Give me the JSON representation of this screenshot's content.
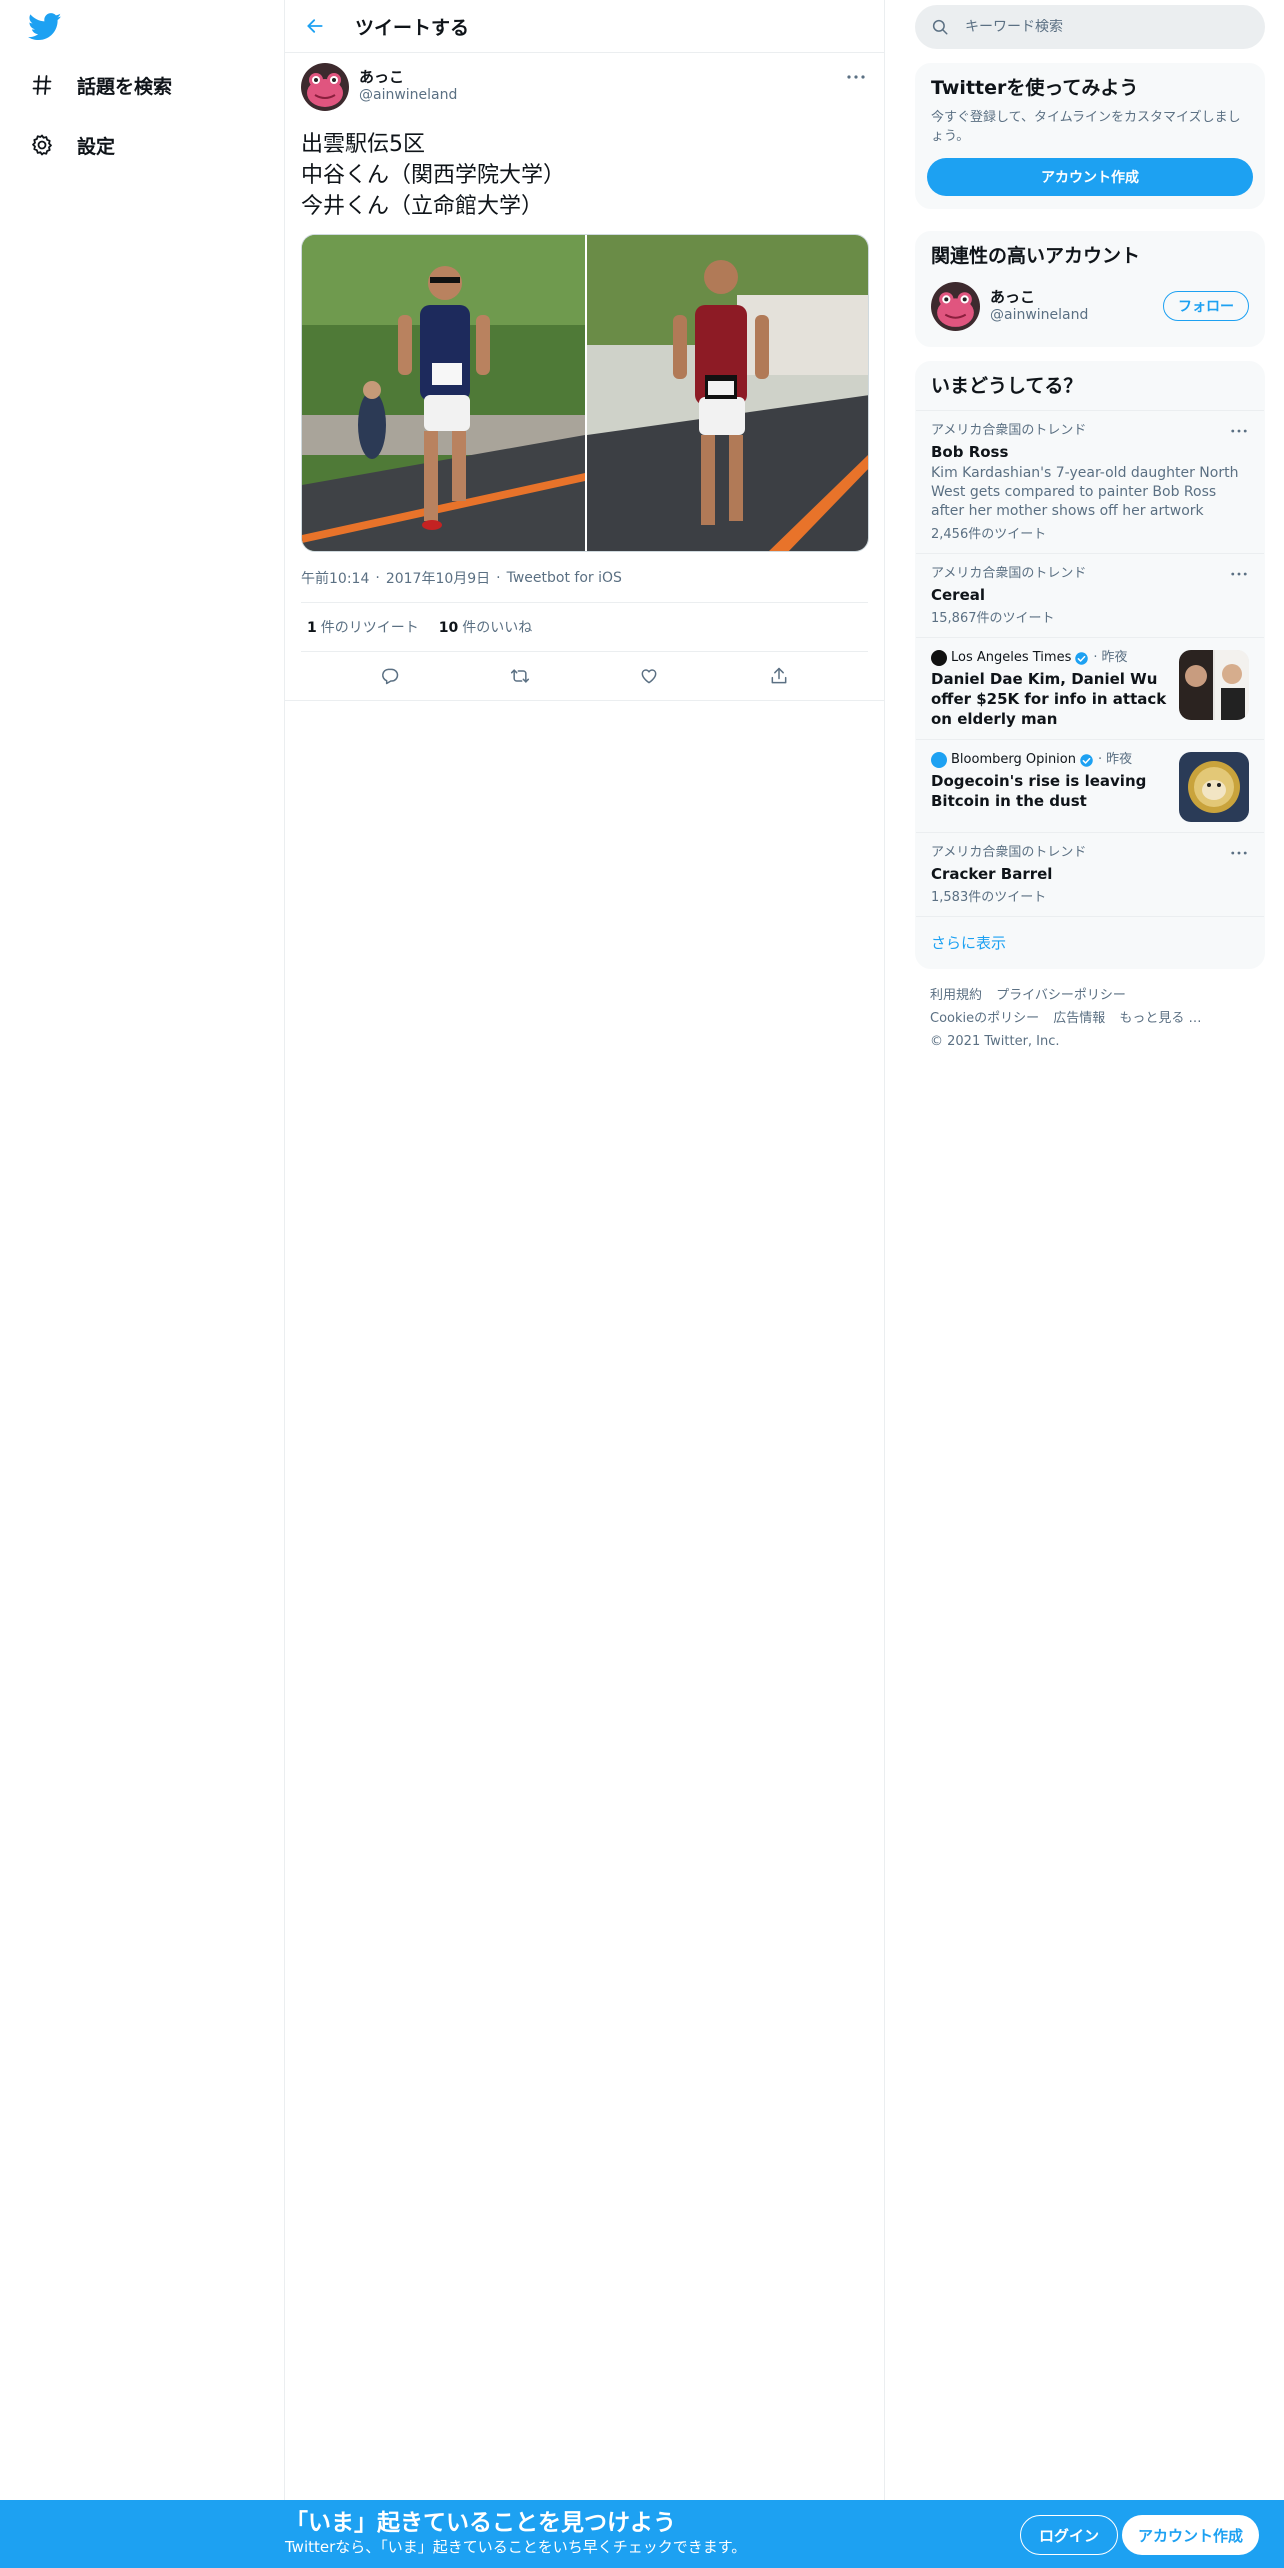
{
  "nav": {
    "logo_icon": "twitter-bird-icon",
    "items": [
      {
        "icon": "hashtag-icon",
        "label": "話題を検索"
      },
      {
        "icon": "gear-icon",
        "label": "設定"
      }
    ]
  },
  "header": {
    "back_icon": "back-arrow-icon",
    "title": "ツイートする"
  },
  "tweet": {
    "author_name": "あっこ",
    "author_handle": "@ainwineland",
    "text_lines": [
      "出雲駅伝5区",
      "中谷くん（関西学院大学）",
      "今井くん（立命館大学）"
    ],
    "time": "午前10:14",
    "date": "2017年10月9日",
    "source": "Tweetbot for iOS",
    "retweet_count": "1",
    "retweet_label": "件のリツイート",
    "like_count": "10",
    "like_label": "件のいいね",
    "photos": [
      {
        "description": "runner-navy-singlet"
      },
      {
        "description": "runner-red-singlet"
      }
    ]
  },
  "sidebar": {
    "search_placeholder": "キーワード検索",
    "signup": {
      "title": "Twitterを使ってみよう",
      "desc": "今すぐ登録して、タイムラインをカスタマイズしましょう。",
      "button": "アカウント作成"
    },
    "related": {
      "title": "関連性の高いアカウント",
      "name": "あっこ",
      "handle": "@ainwineland",
      "follow": "フォロー"
    },
    "trends": {
      "title": "いまどうしてる？",
      "items": [
        {
          "context": "アメリカ合衆国のトレンド",
          "title": "Bob Ross",
          "desc": "Kim Kardashian's 7-year-old daughter North West gets compared to painter Bob Ross after her mother shows off her artwork",
          "count": "2,456件のツイート"
        },
        {
          "context": "アメリカ合衆国のトレンド",
          "title": "Cereal",
          "count": "15,867件のツイート"
        },
        {
          "source": "Los Angeles Times",
          "time": "昨夜",
          "title": "Daniel Dae Kim, Daniel Wu offer $25K for info in attack on elderly man"
        },
        {
          "source": "Bloomberg Opinion",
          "time": "昨夜",
          "title": "Dogecoin's rise is leaving Bitcoin in the dust"
        },
        {
          "context": "アメリカ合衆国のトレンド",
          "title": "Cracker Barrel",
          "count": "1,583件のツイート"
        }
      ],
      "show_more": "さらに表示"
    },
    "footer": {
      "links": [
        "利用規約",
        "プライバシーポリシー",
        "Cookieのポリシー",
        "広告情報",
        "もっと見る …"
      ],
      "copyright": "© 2021 Twitter, Inc."
    }
  },
  "bottombar": {
    "title": "「いま」起きていることを見つけよう",
    "subtitle": "Twitterなら、「いま」起きていることをいち早くチェックできます。",
    "login": "ログイン",
    "signup": "アカウント作成"
  },
  "colors": {
    "accent": "#1da1f2",
    "text": "#0f1419",
    "secondary": "#5b7083",
    "border": "#ebeef0"
  }
}
